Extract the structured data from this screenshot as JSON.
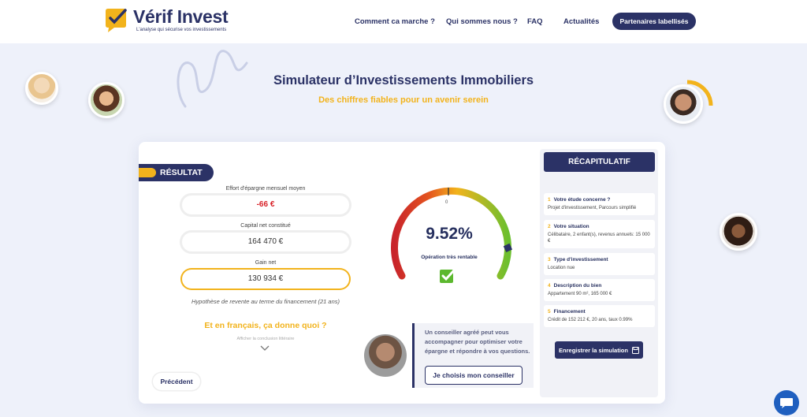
{
  "header": {
    "brand": "Vérif Invest",
    "tagline": "L'analyse qui sécurise vos investissements",
    "nav": [
      "Comment ca marche ?",
      "Qui sommes nous ?",
      "FAQ",
      "Actualités"
    ],
    "cta": "Partenaires labellisés"
  },
  "hero": {
    "title": "Simulateur d’Investissements Immobiliers",
    "subtitle": "Des chiffres fiables pour un avenir serein"
  },
  "result": {
    "tab_label": "RÉSULTAT",
    "fields": [
      {
        "label": "Effort d'épargne mensuel moyen",
        "value": "-66 €"
      },
      {
        "label": "Capital net constitué",
        "value": "164 470 €"
      },
      {
        "label": "Gain net",
        "value": "130 934 €"
      }
    ],
    "hypothesis": "Hypothèse de revente au terme du financement (21 ans)",
    "french_title": "Et en français, ça donne quoi ?",
    "french_sub": "Afficher la conclusion littéraire",
    "previous_button": "Précédent"
  },
  "gauge": {
    "zero_label": "0",
    "value_text": "9.52%",
    "caption": "Opération très rentable",
    "level": 0.88
  },
  "advisor": {
    "text": "Un conseiller agréé peut vous accompagner pour optimiser votre épargne et répondre à vos questions.",
    "button": "Je choisis mon conseiller"
  },
  "recap": {
    "title": "RÉCAPITULATIF",
    "items": [
      {
        "num": "1",
        "title": "Votre étude concerne ?",
        "value": "Projet d'investissement, Parcours simplifié"
      },
      {
        "num": "2",
        "title": "Votre situation",
        "value": "Célibataire, 2 enfant(s), revenus annuels: 15 000 €"
      },
      {
        "num": "3",
        "title": "Type d'investissement",
        "value": "Location nue"
      },
      {
        "num": "4",
        "title": "Description du bien",
        "value": "Appartement 90 m², 165 000 €"
      },
      {
        "num": "5",
        "title": "Financement",
        "value": "Crédit de 152 212 €, 20 ans, taux 0.99%"
      }
    ],
    "save_button": "Enregistrer la simulation"
  },
  "colors": {
    "navy": "#2b3266",
    "gold": "#f2b31c",
    "negative": "#d81f26",
    "positive": "#5cb82e"
  }
}
